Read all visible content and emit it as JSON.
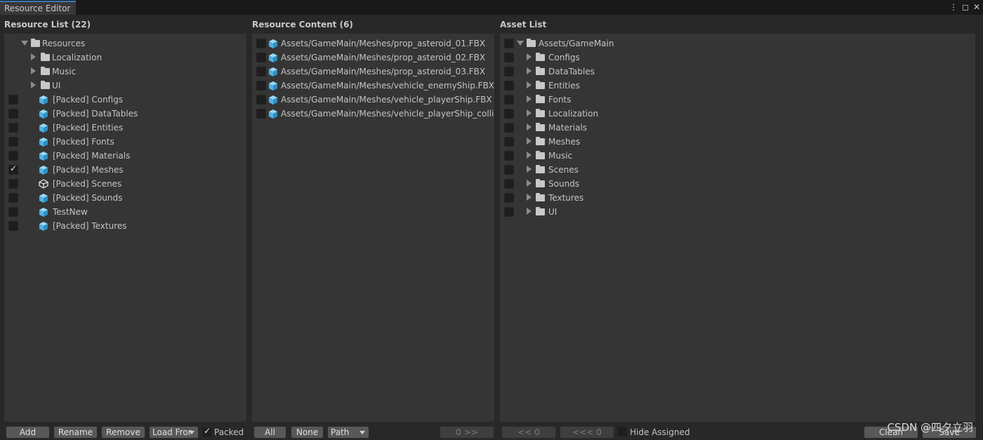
{
  "window": {
    "tab_title": "Resource Editor",
    "menu_icon": "kebab-menu-icon",
    "maximize_icon": "maximize-icon",
    "close_icon": "close-icon"
  },
  "resource_list": {
    "title": "Resource List (22)",
    "root": "Resources",
    "folders": [
      "Localization",
      "Music",
      "UI"
    ],
    "items": [
      {
        "label": "[Packed] Configs",
        "icon": "cube-icon",
        "checked": false
      },
      {
        "label": "[Packed] DataTables",
        "icon": "cube-icon",
        "checked": false
      },
      {
        "label": "[Packed] Entities",
        "icon": "cube-icon",
        "checked": false
      },
      {
        "label": "[Packed] Fonts",
        "icon": "cube-icon",
        "checked": false
      },
      {
        "label": "[Packed] Materials",
        "icon": "cube-icon",
        "checked": false
      },
      {
        "label": "[Packed] Meshes",
        "icon": "cube-icon",
        "checked": true
      },
      {
        "label": "[Packed] Scenes",
        "icon": "unity-scene-icon",
        "checked": false
      },
      {
        "label": "[Packed] Sounds",
        "icon": "cube-icon",
        "checked": false
      },
      {
        "label": "TestNew",
        "icon": "cube-icon",
        "checked": false
      },
      {
        "label": "[Packed] Textures",
        "icon": "cube-icon",
        "checked": false
      }
    ],
    "buttons": {
      "add": "Add",
      "rename": "Rename",
      "remove": "Remove",
      "load_from": "Load Fror"
    },
    "packed_label": "Packed",
    "packed_checked": true
  },
  "resource_content": {
    "title": "Resource Content (6)",
    "items": [
      "Assets/GameMain/Meshes/prop_asteroid_01.FBX",
      "Assets/GameMain/Meshes/prop_asteroid_02.FBX",
      "Assets/GameMain/Meshes/prop_asteroid_03.FBX",
      "Assets/GameMain/Meshes/vehicle_enemyShip.FBX",
      "Assets/GameMain/Meshes/vehicle_playerShip.FBX",
      "Assets/GameMain/Meshes/vehicle_playerShip_collide"
    ],
    "buttons": {
      "all": "All",
      "none": "None",
      "sort": "Path",
      "move_right": "0 >>"
    }
  },
  "asset_list": {
    "title": "Asset List",
    "root": "Assets/GameMain",
    "folders": [
      "Configs",
      "DataTables",
      "Entities",
      "Fonts",
      "Localization",
      "Materials",
      "Meshes",
      "Music",
      "Scenes",
      "Sounds",
      "Textures",
      "UI"
    ],
    "buttons": {
      "move_left": "<< 0",
      "move_all_left": "<<< 0",
      "clean": "Clean",
      "save": "Save"
    },
    "hide_assigned_label": "Hide Assigned",
    "hide_assigned_checked": false
  },
  "watermark": "CSDN @四夕立羽",
  "colors": {
    "accent": "#3a79bb",
    "cube": "#6cc8f0",
    "panel_bg": "#353535",
    "window_bg": "#282828"
  }
}
